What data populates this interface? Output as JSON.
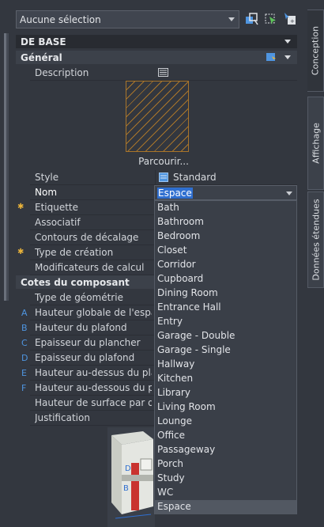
{
  "toolbar": {
    "selection": "Aucune sélection",
    "icons": [
      "quick-select-icon",
      "select-objects-icon",
      "toggle-pickadd-icon"
    ]
  },
  "sections": {
    "base": "DE BASE",
    "general": "Général",
    "cotes": "Cotes du composant"
  },
  "general_rows": {
    "description": "Description",
    "parcourir": "Parcourir...",
    "style": "Style",
    "style_value": "Standard",
    "nom": "Nom",
    "nom_value": "Espace",
    "etiquette": "Etiquette",
    "associatif": "Associatif",
    "contours": "Contours de décalage",
    "type_creation": "Type de création",
    "modificateurs": "Modificateurs de calcul"
  },
  "cotes_rows": [
    {
      "letter": "",
      "label": "Type de géométrie"
    },
    {
      "letter": "A",
      "label": "Hauteur globale de l'espa..."
    },
    {
      "letter": "B",
      "label": "Hauteur du plafond"
    },
    {
      "letter": "C",
      "label": "Epaisseur du plancher"
    },
    {
      "letter": "D",
      "label": "Epaisseur du plafond"
    },
    {
      "letter": "E",
      "label": "Hauteur au-dessus du pla..."
    },
    {
      "letter": "F",
      "label": "Hauteur au-dessous du p..."
    },
    {
      "letter": "",
      "label": "Hauteur de surface par d..."
    },
    {
      "letter": "",
      "label": "Justification"
    }
  ],
  "dropdown": {
    "options": [
      "Bath",
      "Bathroom",
      "Bedroom",
      "Closet",
      "Corridor",
      "Cupboard",
      "Dining Room",
      "Entrance Hall",
      "Entry",
      "Garage - Double",
      "Garage - Single",
      "Hallway",
      "Kitchen",
      "Library",
      "Living Room",
      "Lounge",
      "Office",
      "Passageway",
      "Porch",
      "Study",
      "WC",
      "Espace"
    ],
    "selected": "Espace"
  },
  "tabs": [
    "Conception",
    "Affichage",
    "Données étendues"
  ],
  "colors": {
    "accent": "#2f6fd0",
    "hatch": "#a9752a",
    "star": "#e8b23a",
    "letter": "#4f95e0"
  }
}
